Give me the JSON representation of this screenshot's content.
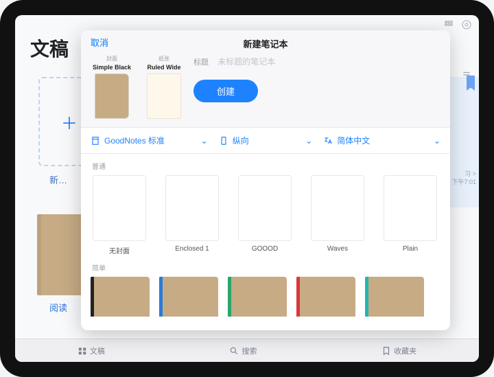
{
  "background": {
    "page_title": "文稿",
    "new_label": "新…",
    "read_label": "阅读",
    "side_text_1": "习 >",
    "side_text_2": "下午7:01"
  },
  "tabbar": {
    "docs": "文稿",
    "search": "搜索",
    "fav": "收藏夹"
  },
  "modal": {
    "cancel": "取消",
    "title": "新建笔记本",
    "cover_caption": "封面",
    "paper_caption": "纸张",
    "cover_name": "Simple Black",
    "paper_name": "Ruled Wide",
    "field_label": "标题",
    "field_placeholder": "未标题的笔记本",
    "create": "创建"
  },
  "filters": {
    "size": "GoodNotes 标准",
    "orient": "纵向",
    "lang": "简体中文"
  },
  "section1": "普通",
  "templates": [
    {
      "name": "无封面"
    },
    {
      "name": "Enclosed 1"
    },
    {
      "name": "GOOOD"
    },
    {
      "name": "Waves"
    },
    {
      "name": "Plain"
    }
  ],
  "section2": "简单"
}
